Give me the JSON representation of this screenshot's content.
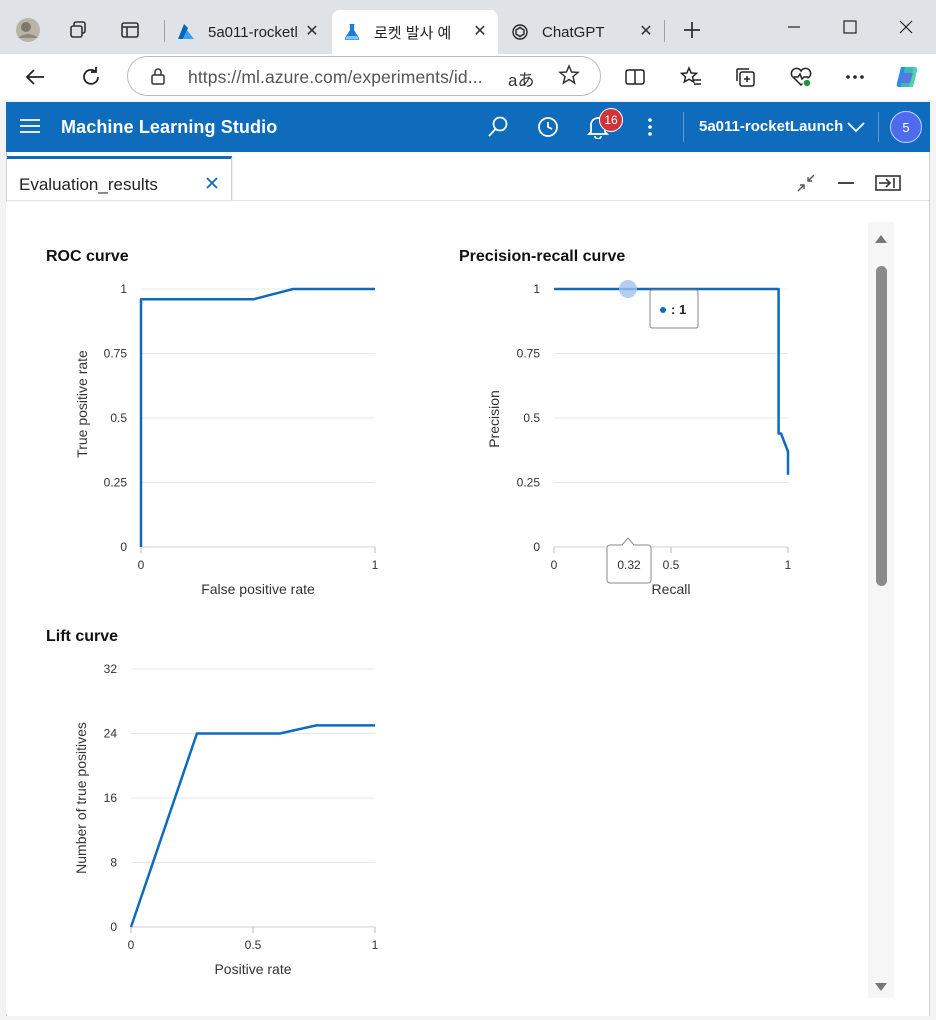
{
  "browser": {
    "tabs": [
      {
        "label": "5a011-rocketl",
        "icon": "azure-icon",
        "active": false
      },
      {
        "label": "로켓 발사 예",
        "icon": "ml-studio-flask-icon",
        "active": true
      },
      {
        "label": "ChatGPT",
        "icon": "chatgpt-icon",
        "active": false
      }
    ],
    "url": "https://ml.azure.com/experiments/id..."
  },
  "app": {
    "title": "Machine Learning Studio",
    "notification_count": "16",
    "workspace": "5a011-rocketLaunch",
    "avatar_initial": "5",
    "accent_color": "#0f6cbd"
  },
  "document_tab": {
    "label": "Evaluation_results"
  },
  "charts": {
    "roc": {
      "title": "ROC curve",
      "xlabel": "False positive rate",
      "ylabel": "True positive rate",
      "xticks": [
        "0",
        "1"
      ],
      "yticks": [
        "0",
        "0.25",
        "0.5",
        "0.75",
        "1"
      ]
    },
    "pr": {
      "title": "Precision-recall curve",
      "xlabel": "Recall",
      "ylabel": "Precision",
      "xticks": [
        "0",
        "0.5",
        "1"
      ],
      "yticks": [
        "0",
        "0.25",
        "0.5",
        "0.75",
        "1"
      ],
      "tooltip_y": ": 1",
      "tooltip_x": "0.32"
    },
    "lift": {
      "title": "Lift curve",
      "xlabel": "Positive rate",
      "ylabel": "Number of true positives",
      "xticks": [
        "0",
        "0.5",
        "1"
      ],
      "yticks": [
        "0",
        "8",
        "16",
        "24",
        "32"
      ]
    }
  },
  "chart_data": [
    {
      "type": "line",
      "title": "ROC curve",
      "xlabel": "False positive rate",
      "ylabel": "True positive rate",
      "xlim": [
        0,
        1
      ],
      "ylim": [
        0,
        1
      ],
      "series": [
        {
          "color": "#0f6cbd",
          "x": [
            0,
            0,
            0.48,
            0.65,
            1
          ],
          "y": [
            0,
            0.96,
            0.96,
            1,
            1
          ]
        }
      ]
    },
    {
      "type": "line",
      "title": "Precision-recall curve",
      "xlabel": "Recall",
      "ylabel": "Precision",
      "xlim": [
        0,
        1
      ],
      "ylim": [
        0,
        1
      ],
      "series": [
        {
          "color": "#0f6cbd",
          "x": [
            0,
            0.32,
            0.96,
            0.96,
            0.97,
            1,
            1
          ],
          "y": [
            1,
            1,
            1,
            0.44,
            0.44,
            0.37,
            0.28
          ]
        }
      ]
    },
    {
      "type": "line",
      "title": "Lift curve",
      "xlabel": "Positive rate",
      "ylabel": "Number of true positives",
      "xlim": [
        0,
        1
      ],
      "ylim": [
        0,
        32
      ],
      "series": [
        {
          "color": "#0f6cbd",
          "x": [
            0,
            0.27,
            0.61,
            0.76,
            1
          ],
          "y": [
            0,
            24,
            24,
            25,
            25
          ]
        }
      ]
    }
  ]
}
